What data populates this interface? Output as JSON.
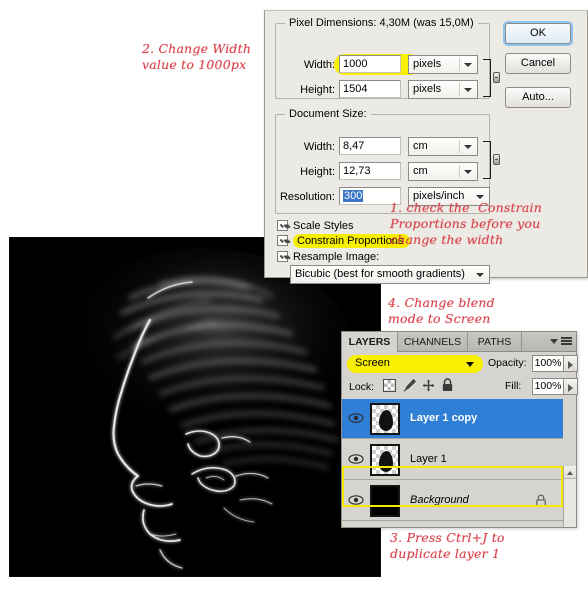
{
  "annotations": [
    {
      "id": "annot-2",
      "text": "2. Change Width\nvalue to 1000px"
    },
    {
      "id": "annot-1",
      "text": "1. check the  Constrain\nProportions before you\nchange the width"
    },
    {
      "id": "annot-4",
      "text": "4. Change blend\nmode to Screen"
    },
    {
      "id": "annot-3",
      "text": "3. Press Ctrl+J to\nduplicate layer 1"
    }
  ],
  "image_size_dialog": {
    "pixel_dimensions": {
      "legend": "Pixel Dimensions:  4,30M (was 15,0M)",
      "width_label": "Width:",
      "width_value": "1000",
      "width_unit": "pixels",
      "height_label": "Height:",
      "height_value": "1504",
      "height_unit": "pixels"
    },
    "document_size": {
      "legend": "Document Size:",
      "width_label": "Width:",
      "width_value": "8,47",
      "width_unit": "cm",
      "height_label": "Height:",
      "height_value": "12,73",
      "height_unit": "cm",
      "resolution_label": "Resolution:",
      "resolution_value": "300",
      "resolution_unit": "pixels/inch"
    },
    "options": {
      "scale_styles": "Scale Styles",
      "constrain_proportions": "Constrain Proportions",
      "resample_image": "Resample Image:",
      "resample_method": "Bicubic (best for smooth gradients)"
    },
    "buttons": {
      "ok": "OK",
      "cancel": "Cancel",
      "auto": "Auto..."
    }
  },
  "layers_panel": {
    "tabs": [
      {
        "label": "LAYERS",
        "active": true
      },
      {
        "label": "CHANNELS",
        "active": false
      },
      {
        "label": "PATHS",
        "active": false
      }
    ],
    "blend_mode": "Screen",
    "opacity_label": "Opacity:",
    "opacity_value": "100%",
    "lock_label": "Lock:",
    "fill_label": "Fill:",
    "fill_value": "100%",
    "layers": [
      {
        "name": "Layer 1 copy",
        "selected": true,
        "italic": false,
        "locked": false,
        "thumb": "transparent-blob"
      },
      {
        "name": "Layer 1",
        "selected": false,
        "italic": false,
        "locked": false,
        "thumb": "transparent-blob"
      },
      {
        "name": "Background",
        "selected": false,
        "italic": true,
        "locked": true,
        "thumb": "solid-black"
      }
    ]
  },
  "colors": {
    "annotation_red": "#d9404a",
    "highlight_yellow": "#f9f000",
    "selection_blue": "#2f7fd6",
    "dialog_bg": "#eceae4",
    "panel_bg": "#d6d4cf"
  }
}
